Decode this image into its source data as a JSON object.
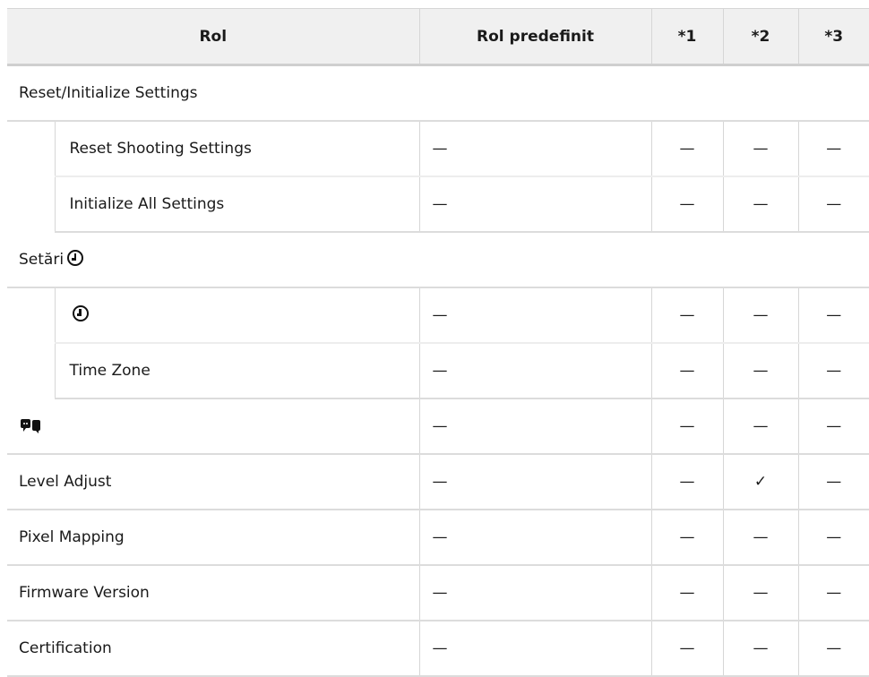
{
  "header": {
    "rol": "Rol",
    "rol_predefinit": "Rol predefinit",
    "c1": "*1",
    "c2": "*2",
    "c3": "*3"
  },
  "groups": {
    "reset": "Reset/Initialize Settings",
    "setari": "Setări"
  },
  "rows": {
    "reset_shooting": "Reset Shooting Settings",
    "initialize_all": "Initialize All Settings",
    "time_zone": "Time Zone",
    "level_adjust": "Level Adjust",
    "pixel_mapping": "Pixel Mapping",
    "firmware_version": "Firmware Version",
    "certification": "Certification"
  },
  "icons": {
    "clock": "clock-icon",
    "language": "language-icon"
  },
  "values": {
    "dash": "—",
    "check": "✓"
  }
}
